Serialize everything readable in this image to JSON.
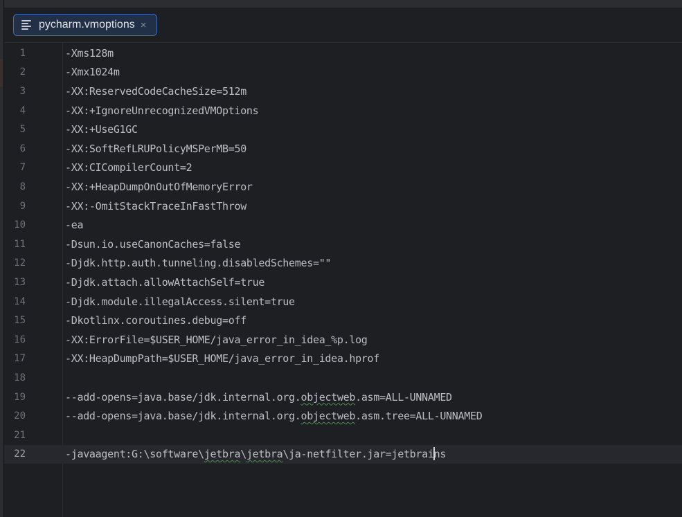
{
  "tab": {
    "filename": "pycharm.vmoptions",
    "close_glyph": "×",
    "icon": "text-file-icon"
  },
  "editor": {
    "current_line": 22,
    "lines": [
      {
        "num": "1",
        "text": "-Xms128m"
      },
      {
        "num": "2",
        "text": "-Xmx1024m"
      },
      {
        "num": "3",
        "text": "-XX:ReservedCodeCacheSize=512m"
      },
      {
        "num": "4",
        "text": "-XX:+IgnoreUnrecognizedVMOptions"
      },
      {
        "num": "5",
        "text": "-XX:+UseG1GC"
      },
      {
        "num": "6",
        "text": "-XX:SoftRefLRUPolicyMSPerMB=50"
      },
      {
        "num": "7",
        "text": "-XX:CICompilerCount=2"
      },
      {
        "num": "8",
        "text": "-XX:+HeapDumpOnOutOfMemoryError"
      },
      {
        "num": "9",
        "text": "-XX:-OmitStackTraceInFastThrow"
      },
      {
        "num": "10",
        "text": "-ea"
      },
      {
        "num": "11",
        "text": "-Dsun.io.useCanonCaches=false"
      },
      {
        "num": "12",
        "text": "-Djdk.http.auth.tunneling.disabledSchemes=\"\""
      },
      {
        "num": "13",
        "text": "-Djdk.attach.allowAttachSelf=true"
      },
      {
        "num": "14",
        "text": "-Djdk.module.illegalAccess.silent=true"
      },
      {
        "num": "15",
        "text": "-Dkotlinx.coroutines.debug=off"
      },
      {
        "num": "16",
        "text": "-XX:ErrorFile=$USER_HOME/java_error_in_idea_%p.log"
      },
      {
        "num": "17",
        "text": "-XX:HeapDumpPath=$USER_HOME/java_error_in_idea.hprof"
      },
      {
        "num": "18",
        "text": ""
      },
      {
        "num": "19",
        "segments": [
          "--add-opens=java.base/jdk.internal.org.",
          "objectweb",
          ".asm=ALL-UNNAMED"
        ]
      },
      {
        "num": "20",
        "segments": [
          "--add-opens=java.base/jdk.internal.org.",
          "objectweb",
          ".asm.tree=ALL-UNNAMED"
        ]
      },
      {
        "num": "21",
        "text": ""
      },
      {
        "num": "22",
        "segments": [
          "-javaagent:G:\\software\\",
          "jetbra",
          "\\",
          "jetbra",
          "\\ja-netfilter.jar=jetbrai",
          "ns"
        ]
      }
    ]
  },
  "colors": {
    "background": "#1e1f22",
    "text": "#bcbec4",
    "line_number": "#6f737a",
    "tab_border": "#3d6fb5",
    "typo_underline": "#4f8d4d"
  }
}
